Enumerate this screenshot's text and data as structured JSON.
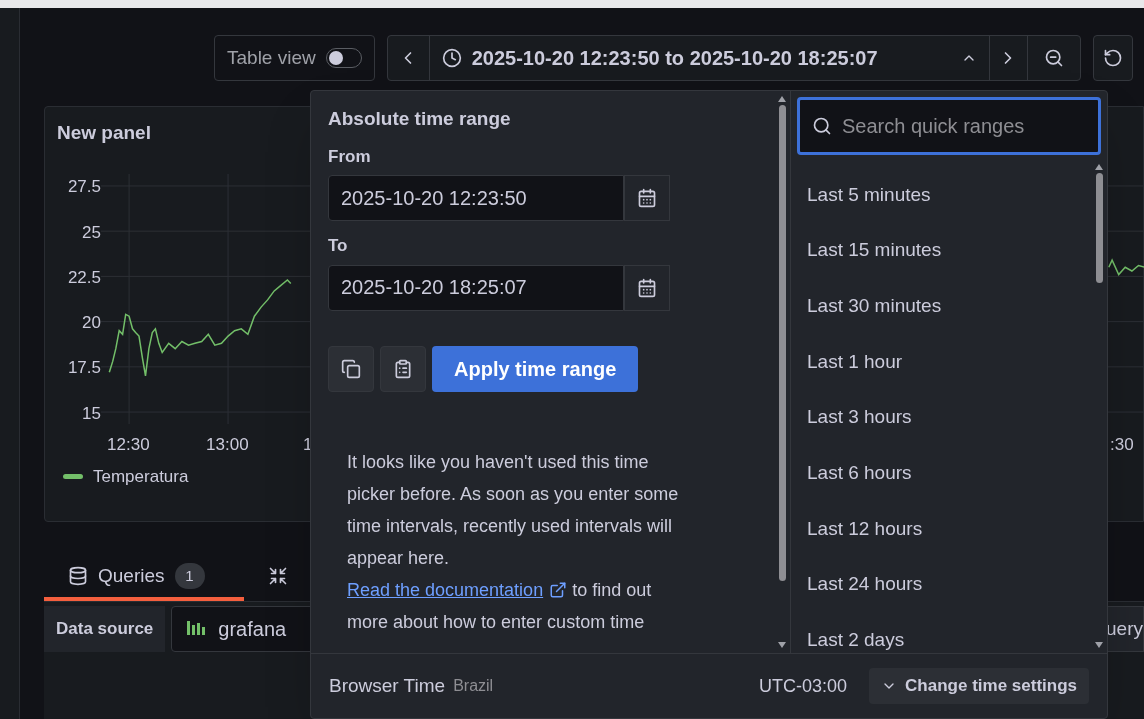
{
  "toolbar": {
    "table_view": {
      "label": "Table view",
      "on": false
    },
    "time_range": "2025-10-20 12:23:50 to 2025-10-20 18:25:07"
  },
  "panel": {
    "title": "New panel",
    "chart_data": {
      "type": "line",
      "grid": true,
      "xlim": [
        12.358,
        17.633
      ],
      "ylim": [
        14.34,
        28.16
      ],
      "yticks": [
        {
          "value": 27.5,
          "label": "27.5"
        },
        {
          "value": 25,
          "label": "25"
        },
        {
          "value": 22.5,
          "label": "22.5"
        },
        {
          "value": 20,
          "label": "20"
        },
        {
          "value": 17.5,
          "label": "17.5"
        },
        {
          "value": 15,
          "label": "15"
        }
      ],
      "xticks": [
        {
          "value": 12.5,
          "label": "12:30"
        },
        {
          "value": 13,
          "label": "13:00"
        }
      ],
      "x": [
        12.4,
        12.417,
        12.433,
        12.45,
        12.467,
        12.483,
        12.5,
        12.517,
        12.533,
        12.55,
        12.567,
        12.583,
        12.6,
        12.617,
        12.633,
        12.65,
        12.667,
        12.7,
        12.733,
        12.767,
        12.8,
        12.833,
        12.867,
        12.9,
        12.933,
        12.967,
        13,
        13.033,
        13.067,
        13.1,
        13.133,
        13.167,
        13.2,
        13.233,
        13.267,
        13.3,
        13.317,
        17.45,
        17.467,
        17.5,
        17.533,
        17.567,
        17.6,
        17.633
      ],
      "series": [
        {
          "name": "Temperatura",
          "color": "#73bf69",
          "values": [
            17.2,
            17.8,
            18.5,
            19.5,
            19.3,
            20.4,
            20.3,
            19.6,
            19.4,
            19.2,
            18.0,
            17.0,
            18.5,
            19.4,
            19.6,
            18.8,
            18.3,
            18.8,
            18.5,
            18.9,
            18.7,
            18.8,
            18.9,
            19.3,
            18.7,
            18.8,
            19.2,
            19.5,
            19.6,
            19.3,
            20.3,
            20.8,
            21.2,
            21.7,
            22.0,
            22.3,
            22.1,
            23.0,
            23.4,
            22.6,
            23.0,
            22.8,
            23.1,
            23.0
          ]
        }
      ]
    },
    "x_axis_cut_labels": [
      "1",
      ":30"
    ]
  },
  "editor_tabs": [
    {
      "kind": "queries",
      "label": "Queries",
      "count": "1",
      "selected": true
    },
    {
      "kind": "transform",
      "selected": false
    }
  ],
  "data_source": {
    "label": "Data source",
    "value": "grafana",
    "query_button": "uery"
  },
  "time_picker": {
    "heading": "Absolute time range",
    "from_label": "From",
    "from_value": "2025-10-20 12:23:50",
    "to_label": "To",
    "to_value": "2025-10-20 18:25:07",
    "apply_button": "Apply time range",
    "note": "It looks like you haven't used this time picker before. As soon as you enter some time intervals, recently used intervals will appear here.",
    "doc_link": "Read the documentation",
    "note_after_link": "to find out more about how to enter custom time",
    "search": {
      "placeholder": "Search quick ranges"
    },
    "quick_ranges": [
      "Last 5 minutes",
      "Last 15 minutes",
      "Last 30 minutes",
      "Last 1 hour",
      "Last 3 hours",
      "Last 6 hours",
      "Last 12 hours",
      "Last 24 hours",
      "Last 2 days"
    ],
    "footer": {
      "zone": "Browser Time",
      "zone_detail": "Brazil",
      "offset": "UTC-03:00",
      "settings_button": "Change time settings"
    }
  }
}
